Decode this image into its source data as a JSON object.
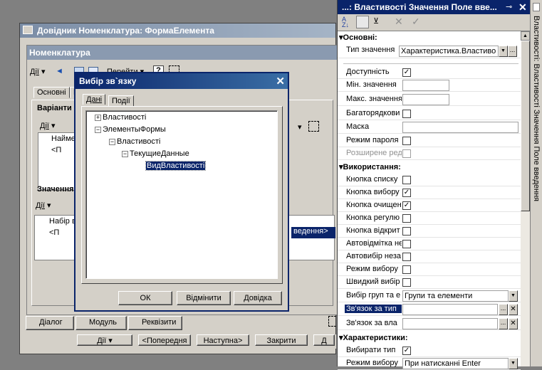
{
  "bg_window": {
    "title": "Довідник Номенклатура: ФормаЕлемента",
    "form_title": "Номенклатура",
    "toolbar": {
      "actions": "Дії",
      "goto": "Перейти",
      "help": "?"
    },
    "tabs": [
      "Основні",
      "П"
    ],
    "group_variants": "Варіанти",
    "group_values": "Значення",
    "toolbar2_actions": "Дії",
    "toolbar3_actions": "Дії",
    "col_name": "Наймен",
    "row_prefix": "<П",
    "col_set": "Набір в",
    "row_set": "<П",
    "row_suffix": "ведення>",
    "bottom_tabs": [
      "Діалог",
      "Модуль",
      "Реквізити"
    ],
    "nav_buttons": [
      "Дії",
      "<Попередня",
      "Наступна>",
      "Закрити",
      "Д"
    ]
  },
  "dialog": {
    "title": "Вибір зв`язку",
    "tabs": [
      "Дані",
      "Події"
    ],
    "tree": [
      {
        "label": "Властивості",
        "indent": 0,
        "expander": "+"
      },
      {
        "label": "ЭлементыФормы",
        "indent": 0,
        "expander": "−"
      },
      {
        "label": "Властивості",
        "indent": 1,
        "expander": "−"
      },
      {
        "label": "ТекущиеДанные",
        "indent": 2,
        "expander": "−"
      },
      {
        "label": "ВидВластивості",
        "indent": 3,
        "expander": "",
        "selected": true
      }
    ],
    "ok": "ОК",
    "cancel": "Відмінити",
    "help": "Довідка"
  },
  "props": {
    "title": "...: Властивості Значення Поле вве...",
    "pin": "⊸",
    "side_tab": "Властивості: Властивості Значення Поле введення",
    "sections": {
      "main": "Основні:",
      "usage": "Використання:",
      "chars": "Характеристики:"
    },
    "rows": {
      "type_label": "Тип значення",
      "type_value": "Характеристика.Властиво",
      "enabled_label": "Доступність",
      "min_label": "Мін. значення",
      "max_label": "Макс. значення",
      "multiline_label": "Багаторядкови",
      "mask_label": "Маска",
      "password_label": "Режим пароля",
      "extended_label": "Розширене ред",
      "list_btn_label": "Кнопка списку",
      "choose_btn_label": "Кнопка вибору",
      "clear_btn_label": "Кнопка очищен",
      "reg_btn_label": "Кнопка регулю",
      "open_btn_label": "Кнопка відкрит",
      "automark_label": "Автовідмітка не",
      "autochoose_label": "Автовибір незa",
      "choose_mode_label": "Режим вибору",
      "quick_label": "Швидкий вибір",
      "groups_label": "Вибір груп та е",
      "groups_value": "Групи та елементи",
      "link_type_label": "Зв'язок за тип",
      "link_own_label": "Зв'язок за вла",
      "choose_type_label": "Вибирати тип",
      "choose_mode2_label": "Режим вибору",
      "choose_mode2_value": "При натисканні Enter"
    },
    "checks": {
      "enabled": true,
      "multiline": false,
      "password": false,
      "extended": false,
      "list_btn": false,
      "choose_btn": true,
      "clear_btn": true,
      "reg_btn": false,
      "open_btn": false,
      "automark": false,
      "autochoose": false,
      "choose_mode": false,
      "quick": false,
      "choose_type": true
    }
  }
}
